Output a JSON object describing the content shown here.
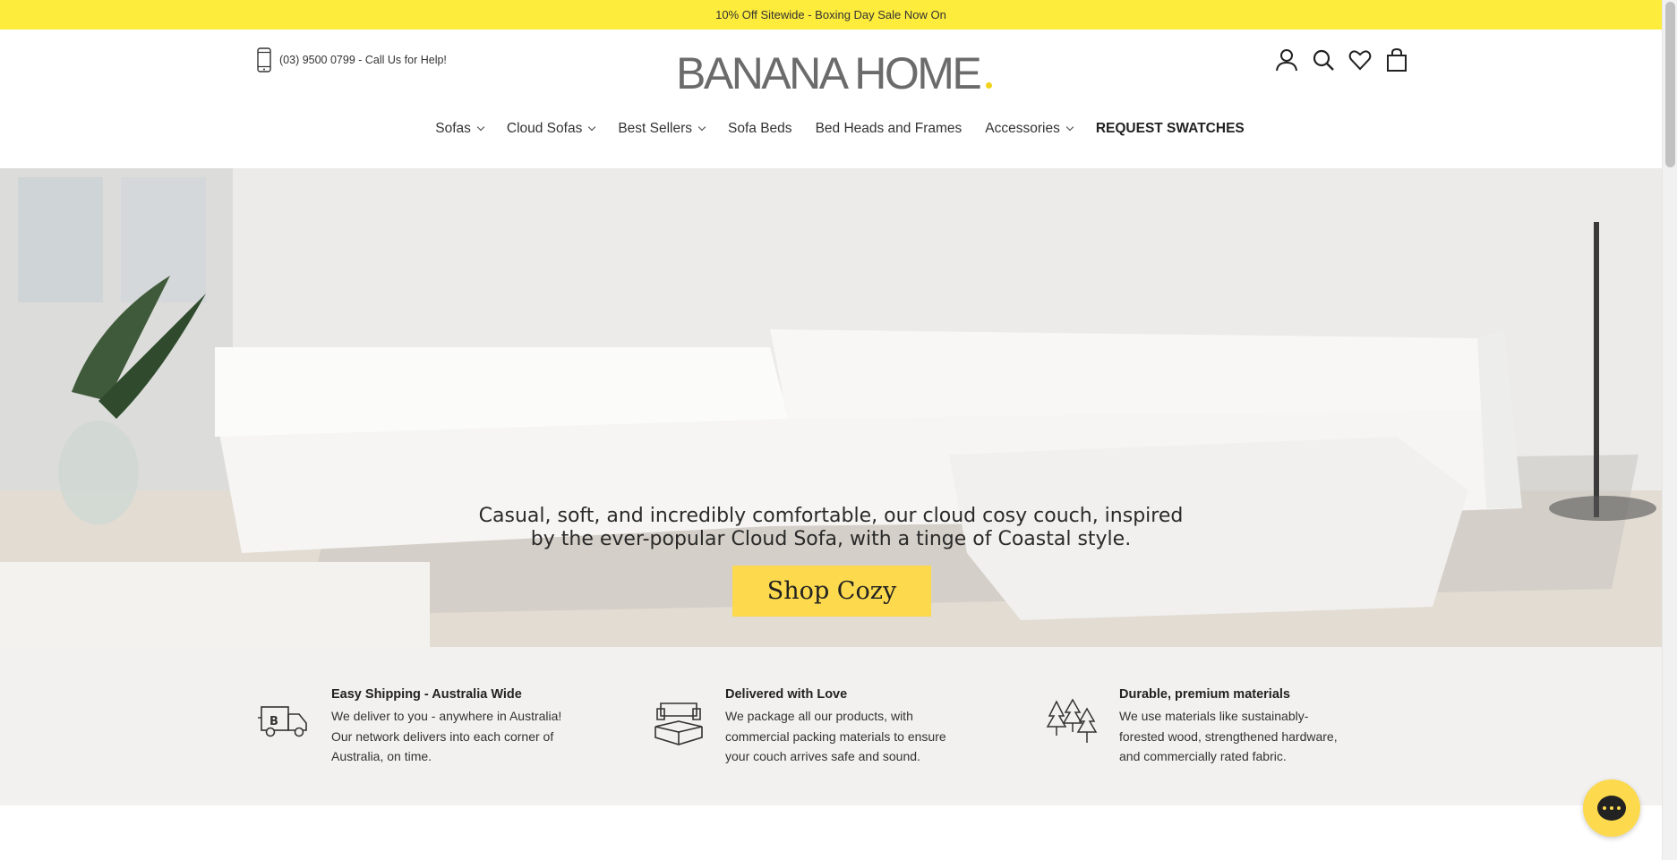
{
  "announcement": "10% Off Sitewide - Boxing Day Sale Now On",
  "header": {
    "phone": "(03) 9500 0799 - Call Us for Help!",
    "logo": "BANANA HOME",
    "icons": [
      "account-icon",
      "search-icon",
      "wishlist-heart-icon",
      "cart-bag-icon"
    ]
  },
  "nav": [
    {
      "label": "Sofas",
      "dropdown": true
    },
    {
      "label": "Cloud Sofas",
      "dropdown": true
    },
    {
      "label": "Best Sellers",
      "dropdown": true
    },
    {
      "label": "Sofa Beds",
      "dropdown": false
    },
    {
      "label": "Bed Heads and Frames",
      "dropdown": false
    },
    {
      "label": "Accessories",
      "dropdown": true
    },
    {
      "label": "REQUEST SWATCHES",
      "dropdown": false
    }
  ],
  "hero": {
    "line1": "Casual, soft, and incredibly comfortable, our cloud cosy couch, inspired",
    "line2": "by the ever-popular Cloud Sofa, with a tinge of Coastal style.",
    "button": "Shop Cozy"
  },
  "features": [
    {
      "title": "Easy Shipping - Australia Wide",
      "text": "We deliver to you - anywhere in Australia! Our network delivers into each corner of Australia, on time.",
      "icon": "delivery-truck-icon"
    },
    {
      "title": "Delivered with Love",
      "text": "We package all our products, with commercial packing materials to ensure your couch arrives safe and sound.",
      "icon": "packaged-sofa-icon"
    },
    {
      "title": "Durable, premium materials",
      "text": "We use materials like sustainably-forested wood, strengthened hardware, and commercially rated fabric.",
      "icon": "trees-icon"
    }
  ],
  "colors": {
    "accent_yellow": "#fdec3c",
    "button_yellow": "#fcd94d",
    "features_bg": "#f3f1ef"
  }
}
